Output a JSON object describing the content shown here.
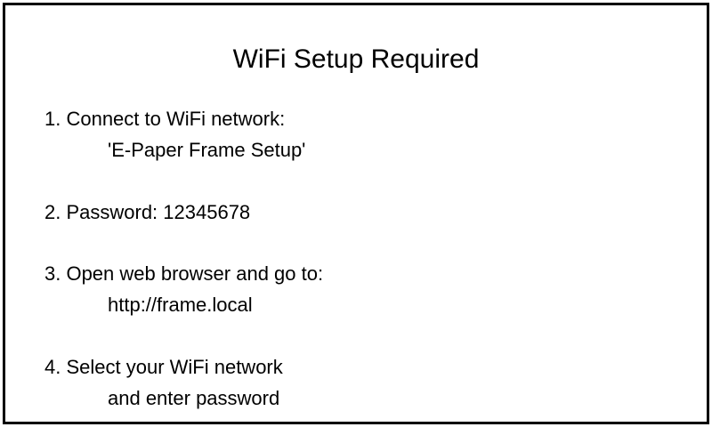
{
  "title": "WiFi Setup Required",
  "steps": [
    {
      "text": "1. Connect to WiFi network:",
      "detail": "'E-Paper Frame Setup'"
    },
    {
      "text": "2. Password: 12345678"
    },
    {
      "text": "3. Open web browser and go to:",
      "detail": "http://frame.local"
    },
    {
      "text": "4. Select your WiFi network",
      "detail": "and enter password"
    }
  ]
}
